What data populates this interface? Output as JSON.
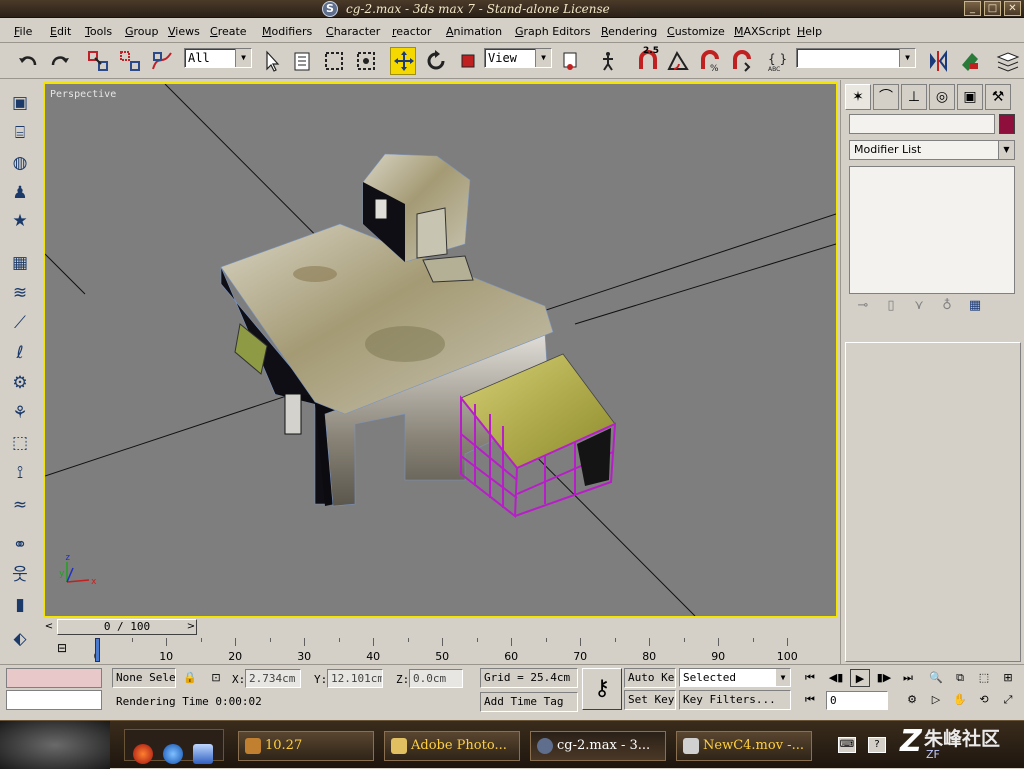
{
  "window": {
    "title": "cg-2.max - 3ds max 7  - Stand-alone License",
    "minimize": "_",
    "maximize": "□",
    "close": "✕"
  },
  "menu": [
    "File",
    "Edit",
    "Tools",
    "Group",
    "Views",
    "Create",
    "Modifiers",
    "Character",
    "reactor",
    "Animation",
    "Graph Editors",
    "Rendering",
    "Customize",
    "MAXScript",
    "Help"
  ],
  "toolbar": {
    "selection_filter": "All",
    "reference_coord": "View",
    "snap_angle_label": "2.5",
    "named_selection": ""
  },
  "viewport": {
    "label": "Perspective",
    "axis_x": "x",
    "axis_y": "y",
    "axis_z": "z"
  },
  "command_panel": {
    "modifier_list": "Modifier List",
    "object_color": "#8e0f3c"
  },
  "time_slider": {
    "frame_display": "0 / 100",
    "ticks": [
      "0",
      "10",
      "20",
      "30",
      "40",
      "50",
      "60",
      "70",
      "80",
      "90",
      "100"
    ]
  },
  "status": {
    "selection": "None Sele",
    "rendering_time": "Rendering Time  0:00:02",
    "x_label": "X:",
    "x_value": "2.734cm",
    "y_label": "Y:",
    "y_value": "12.101cm",
    "z_label": "Z:",
    "z_value": "0.0cm",
    "grid": "Grid = 25.4cm",
    "add_time_tag": "Add Time Tag",
    "auto_key": "Auto Key",
    "set_key": "Set Key",
    "key_mode": "Selected",
    "key_filters": "Key Filters...",
    "current_frame": "0"
  },
  "taskbar": {
    "tasks": [
      "10.27",
      "Adobe Photo...",
      "cg-2.max - 3...",
      "NewC4.mov -..."
    ]
  },
  "watermark": {
    "text": "朱峰社区",
    "sub": "ZF"
  }
}
